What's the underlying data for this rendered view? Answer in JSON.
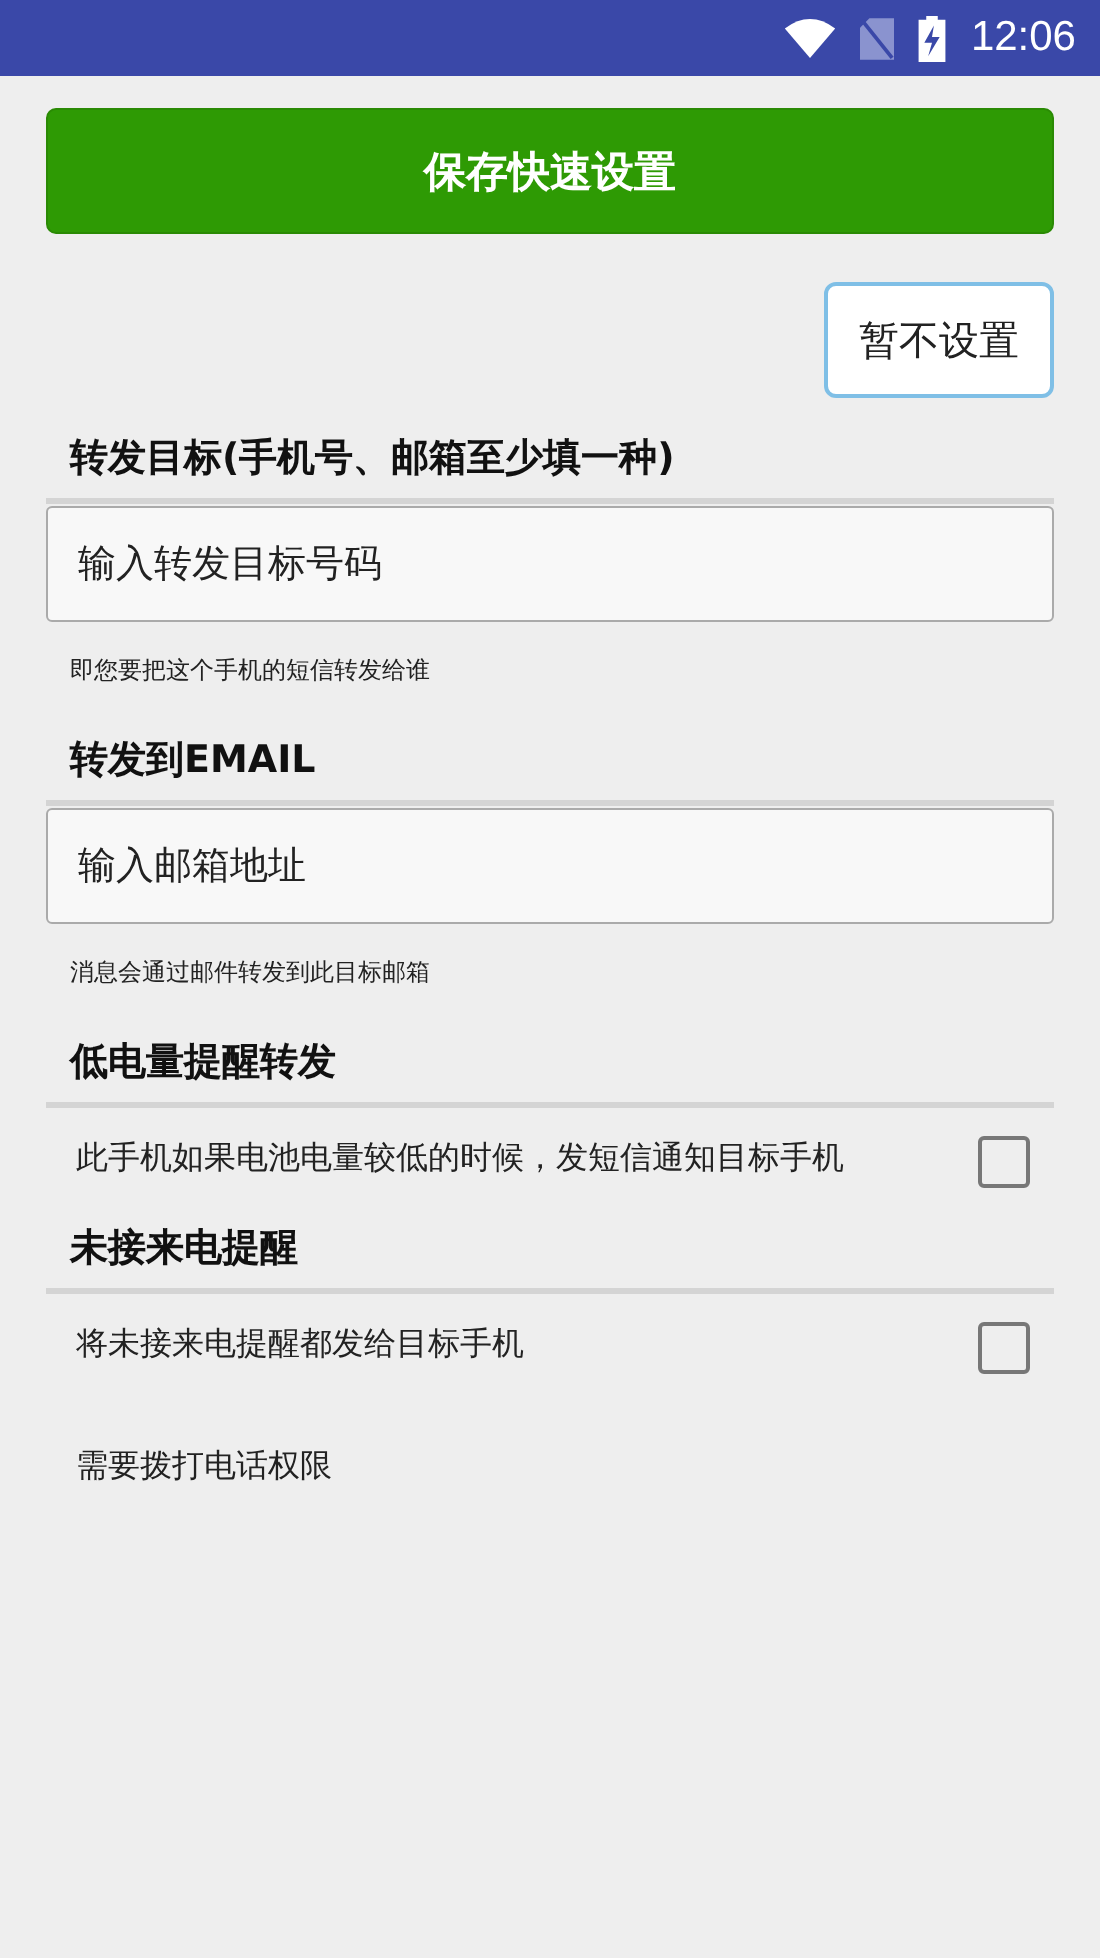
{
  "status_bar": {
    "time": "12:06"
  },
  "save_button": "保存快速设置",
  "skip_button": "暂不设置",
  "sections": [
    {
      "title": "转发目标(手机号、邮箱至少填一种)",
      "kind": "field",
      "placeholder": "输入转发目标号码",
      "hint": "即您要把这个手机的短信转发给谁"
    },
    {
      "title": "转发到EMAIL",
      "kind": "field",
      "placeholder": "输入邮箱地址",
      "hint": "消息会通过邮件转发到此目标邮箱"
    },
    {
      "title": "低电量提醒转发",
      "kind": "checkbox",
      "label": "此手机如果电池电量较低的时候，发短信通知目标手机",
      "checked": false
    },
    {
      "title": "未接来电提醒",
      "kind": "checkbox",
      "label": "将未接来电提醒都发给目标手机",
      "checked": false,
      "note": "需要拨打电话权限"
    }
  ]
}
